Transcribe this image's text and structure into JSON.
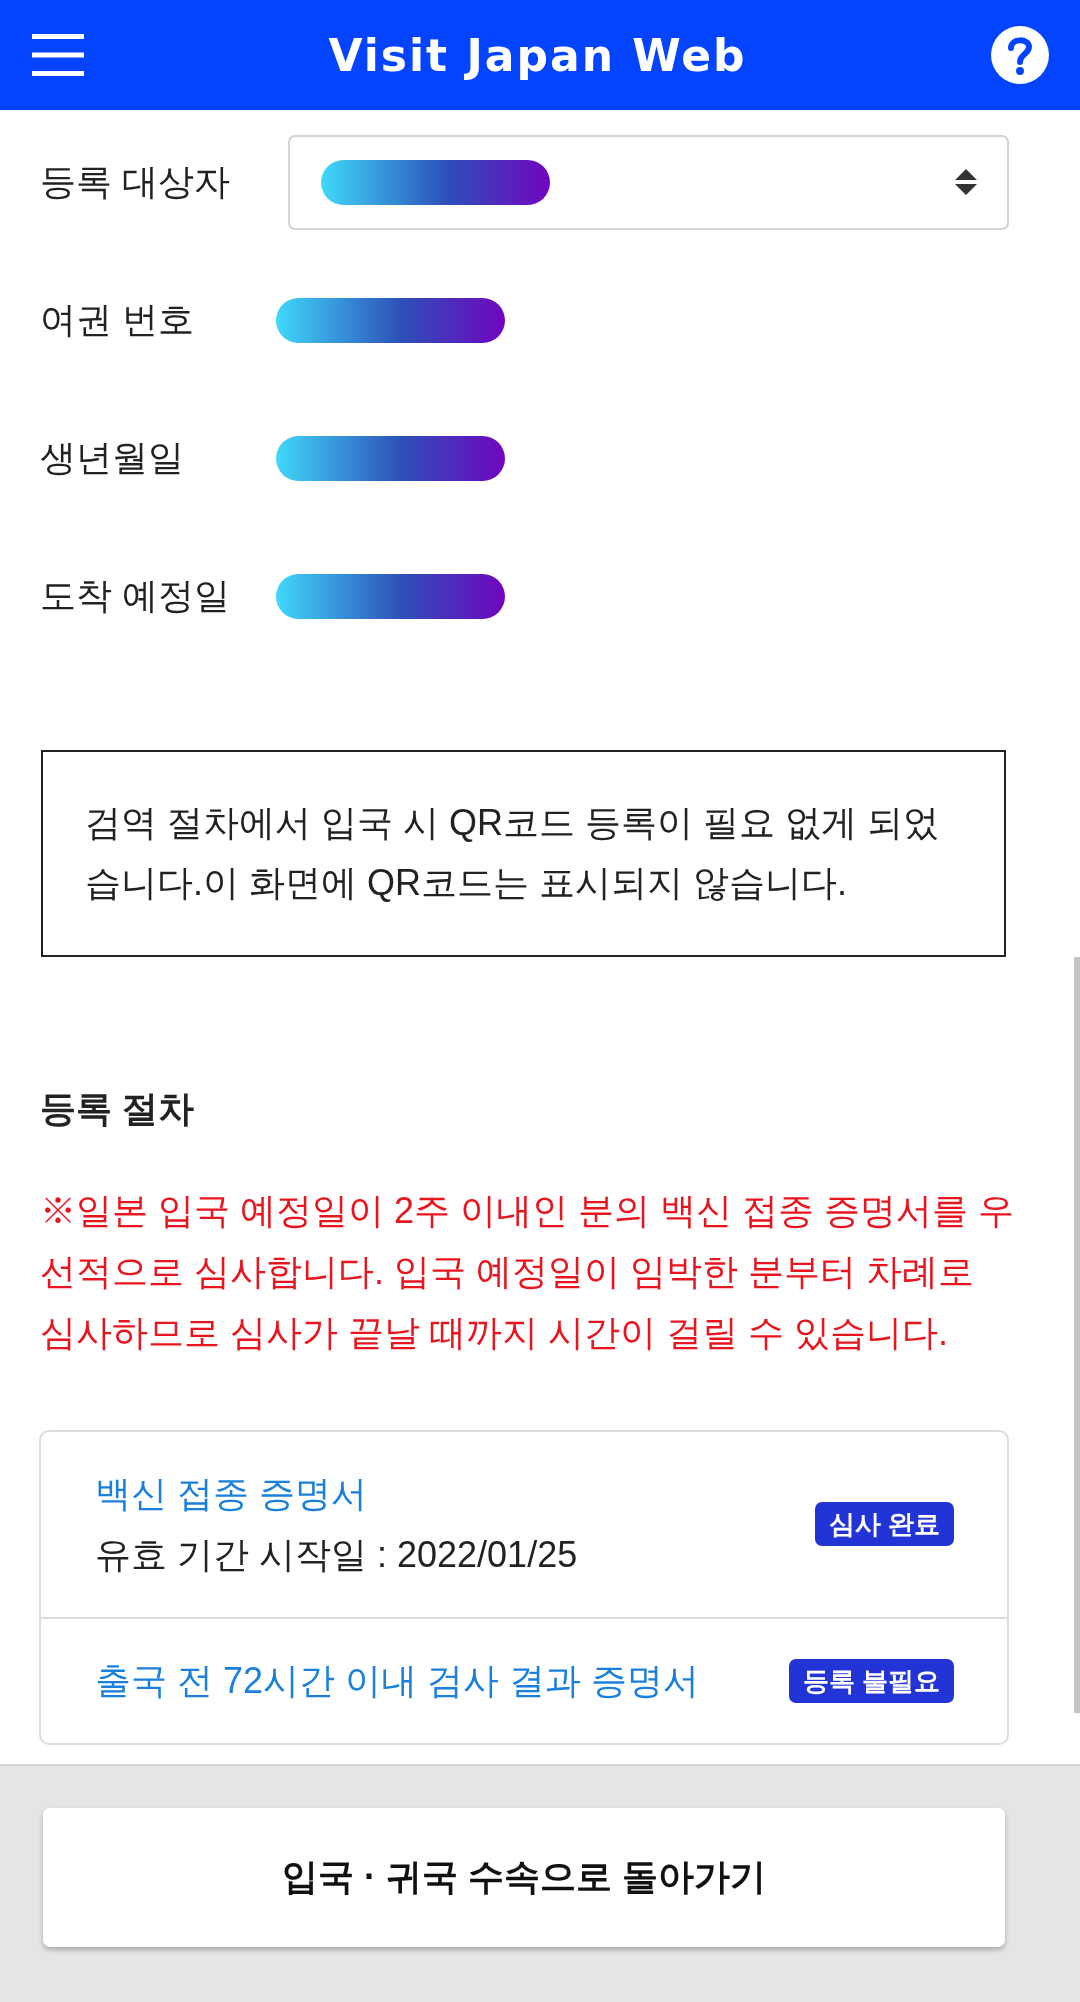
{
  "header": {
    "title": "Visit Japan Web"
  },
  "fields": [
    {
      "kind": "select",
      "label": "등록 대상자",
      "redacted": true
    },
    {
      "kind": "text",
      "label": "여권 번호",
      "redacted": true
    },
    {
      "kind": "text",
      "label": "생년월일",
      "redacted": true
    },
    {
      "kind": "text",
      "label": "도착 예정일",
      "redacted": true
    }
  ],
  "notice": {
    "text": "검역 절차에서 입국 시 QR코드 등록이 필요 없게 되었습니다.이 화면에 QR코드는 표시되지 않습니다."
  },
  "registration": {
    "title": "등록 절차",
    "warning": "※일본 입국 예정일이 2주 이내인 분의 백신 접종 증명서를 우선적으로 심사합니다. 입국 예정일이 임박한 분부터 차례로 심사하므로 심사가 끝날 때까지 시간이 걸릴 수 있습니다.",
    "documents": [
      {
        "title": "백신 접종 증명서",
        "detail": "유효 기간 시작일 : 2022/01/25",
        "status": "심사 완료"
      },
      {
        "title": "출국 전 72시간 이내 검사 결과 증명서",
        "status": "등록 불필요"
      }
    ]
  },
  "footer": {
    "button": "입국 · 귀국 수속으로 돌아가기"
  }
}
